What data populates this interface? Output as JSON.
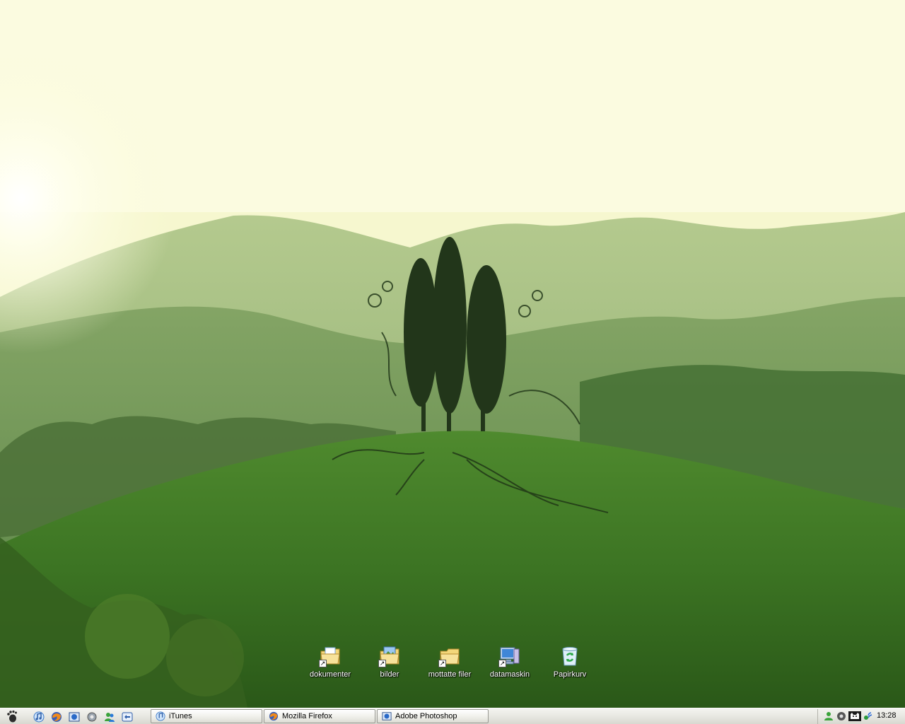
{
  "desktop": {
    "icons": [
      {
        "label": "dokumenter",
        "icon": "documents-folder-icon"
      },
      {
        "label": "bilder",
        "icon": "pictures-folder-icon"
      },
      {
        "label": "mottatte filer",
        "icon": "received-files-folder-icon"
      },
      {
        "label": "datamaskin",
        "icon": "computer-icon"
      },
      {
        "label": "Papirkurv",
        "icon": "recycle-bin-icon"
      }
    ]
  },
  "taskbar": {
    "start_icon": "gnome-foot-icon",
    "quicklaunch": [
      "itunes-icon",
      "firefox-icon",
      "photoshop-icon",
      "settings-icon",
      "messenger-icon",
      "desktop-icon"
    ],
    "tasks": [
      {
        "label": "iTunes",
        "icon": "itunes-icon"
      },
      {
        "label": "Mozilla Firefox",
        "icon": "firefox-icon"
      },
      {
        "label": "Adobe Photoshop",
        "icon": "photoshop-icon"
      }
    ],
    "tray_icons": [
      "messenger-status-icon",
      "volume-icon",
      "cat-icon",
      "network-icon"
    ],
    "clock": "13:28"
  },
  "colors": {
    "sky": "#f7f8d2",
    "hill": "#3f7430",
    "taskbar": "#e8e8e2"
  }
}
